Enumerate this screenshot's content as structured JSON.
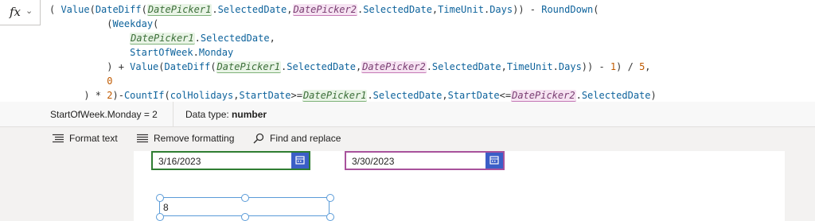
{
  "formula_bar": {
    "fx_label": "fx",
    "lines": [
      "( Value(DateDiff(DatePicker1.SelectedDate,DatePicker2.SelectedDate,TimeUnit.Days)) - RoundDown(",
      "          (Weekday(",
      "              DatePicker1.SelectedDate,",
      "              StartOfWeek.Monday",
      "          ) + Value(DateDiff(DatePicker1.SelectedDate,DatePicker2.SelectedDate,TimeUnit.Days)) - 1) / 5,",
      "          0",
      "      ) * 2)-CountIf(colHolidays,StartDate>=DatePicker1.SelectedDate,StartDate<=DatePicker2.SelectedDate)"
    ]
  },
  "result_bar": {
    "expression": "StartOfWeek.Monday  =  2",
    "data_type_label": "Data type: ",
    "data_type_value": "number"
  },
  "toolbar": {
    "format_text": "Format text",
    "remove_formatting": "Remove formatting",
    "find_replace": "Find and replace"
  },
  "canvas": {
    "date_picker_1": "3/16/2023",
    "date_picker_2": "3/30/2023",
    "label_value": "8"
  },
  "colors": {
    "picker1_border": "#2f7d32",
    "picker2_border": "#a8529c",
    "calendar_button": "#3b5ec7",
    "selection": "#5a9bd8"
  }
}
